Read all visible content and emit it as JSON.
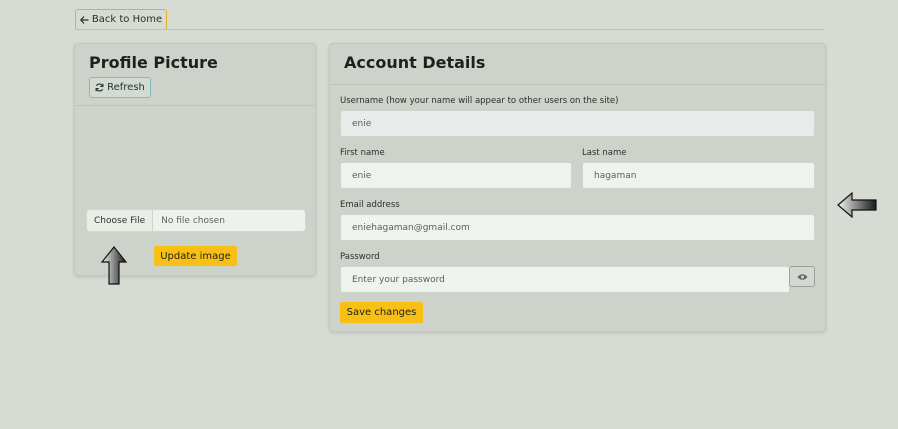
{
  "nav": {
    "back_label": "Back to Home"
  },
  "profile": {
    "title": "Profile Picture",
    "refresh_label": "Refresh",
    "choose_file_label": "Choose File",
    "file_status": "No file chosen",
    "update_label": "Update image"
  },
  "account": {
    "title": "Account Details",
    "username_label": "Username (how your name will appear to other users on the site)",
    "username_value": "enie",
    "first_name_label": "First name",
    "first_name_value": "enie",
    "last_name_label": "Last name",
    "last_name_value": "hagaman",
    "email_label": "Email address",
    "email_value": "eniehagaman@gmail.com",
    "password_label": "Password",
    "password_placeholder": "Enter your password",
    "save_label": "Save changes"
  },
  "colors": {
    "accent": "#f8bf14",
    "background": "#d6dbd4",
    "card": "#cdd3cb"
  },
  "icons": {
    "back": "arrow-left-icon",
    "refresh": "refresh-icon",
    "password_toggle": "eye-icon",
    "pointer_up": "arrow-up-icon",
    "pointer_left": "arrow-left-pointer-icon"
  }
}
